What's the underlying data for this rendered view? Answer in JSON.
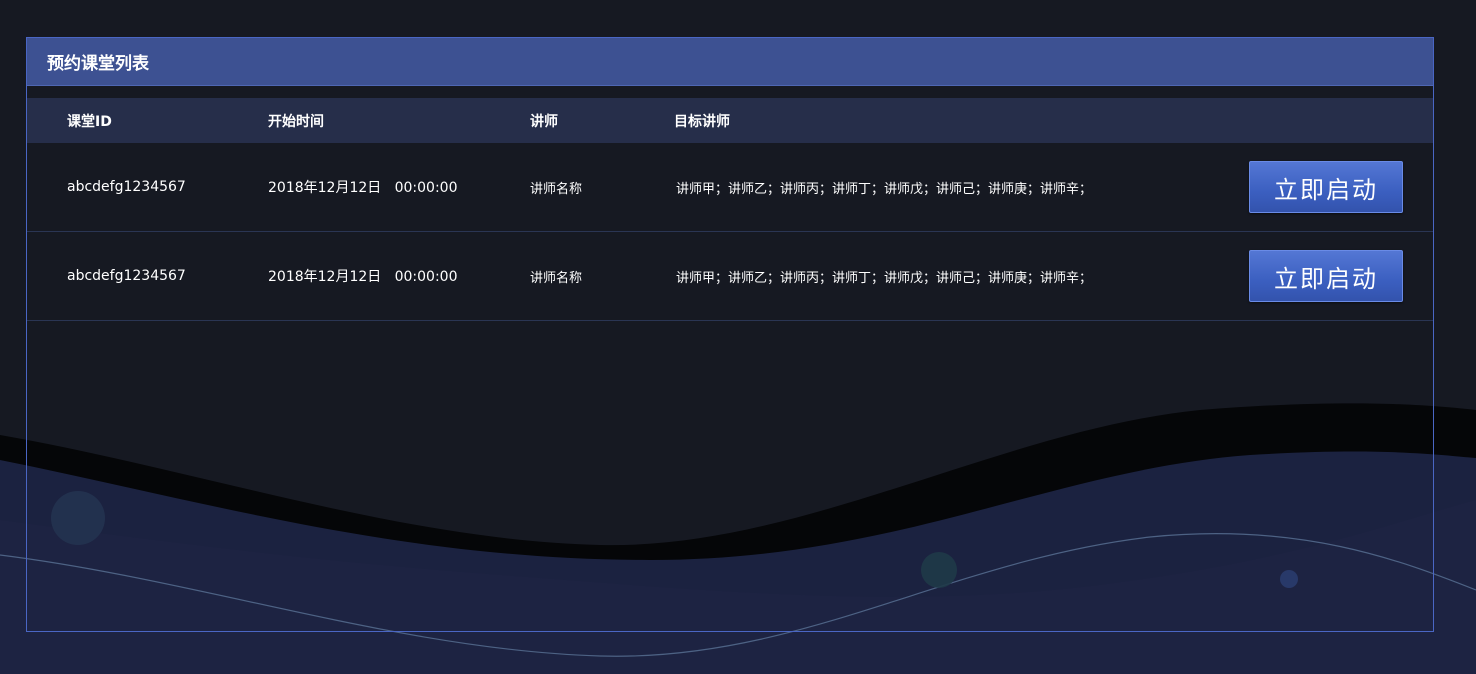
{
  "panel": {
    "title": "预约课堂列表"
  },
  "table": {
    "headers": {
      "id": "课堂ID",
      "start_time": "开始时间",
      "teacher": "讲师",
      "target_teachers": "目标讲师"
    },
    "rows": [
      {
        "id": "abcdefg1234567",
        "start_time": "2018年12月12日   00:00:00",
        "teacher": "讲师名称",
        "target_teachers": "讲师甲；讲师乙；讲师丙；讲师丁；讲师戊；讲师己；讲师庚；讲师辛；",
        "action_label": "立即启动"
      },
      {
        "id": "abcdefg1234567",
        "start_time": "2018年12月12日   00:00:00",
        "teacher": "讲师名称",
        "target_teachers": "讲师甲；讲师乙；讲师丙；讲师丁；讲师戊；讲师己；讲师庚；讲师辛；",
        "action_label": "立即启动"
      }
    ]
  },
  "colors": {
    "background": "#161922",
    "panel_header": "#3d5192",
    "table_header": "#262e4a",
    "button": "#3b5fc0",
    "border": "#4a66c4"
  }
}
